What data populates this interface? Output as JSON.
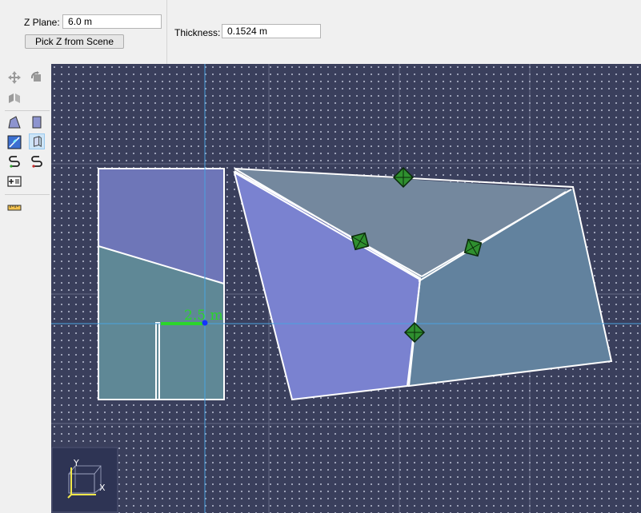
{
  "zplane": {
    "label": "Z Plane:",
    "value": "6.0 m",
    "pick_button": "Pick Z from Scene"
  },
  "thickness": {
    "label": "Thickness:",
    "value": "0.1524 m"
  },
  "viewport": {
    "dimension_label": "2.5 m",
    "axis_y": "Y",
    "axis_x": "X"
  },
  "toolbar": {
    "icons": [
      "move-icon",
      "rotate-icon",
      "mirror-icon",
      "draw-surface-icon",
      "draw-wall-icon",
      "split-icon",
      "extrude-icon",
      "connect-icon",
      "disconnect-icon",
      "add-space-icon",
      "measure-icon"
    ]
  },
  "colors": {
    "background": "#3a3f5c",
    "grid_dot": "#aeb4c8",
    "guide": "#4aa3e0",
    "surface_purple": "#6e76b8",
    "surface_teal": "#5f8896",
    "surface_violet": "#7a82d0",
    "surface_slate": "#74889e",
    "surface_steel": "#62829e",
    "dimension": "#2bd62b",
    "handle": "#2f8f2f"
  }
}
